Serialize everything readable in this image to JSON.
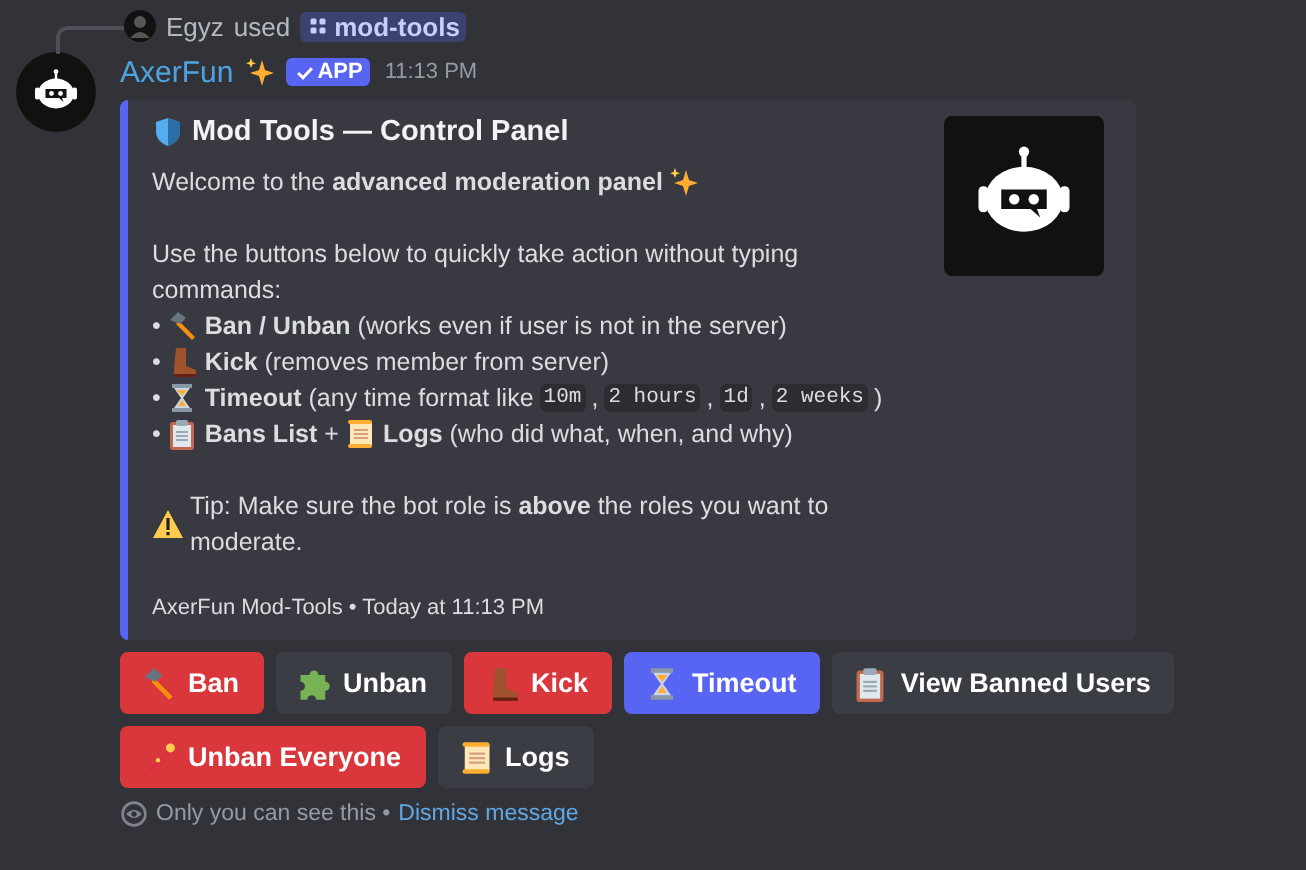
{
  "reply": {
    "user": "Egyz",
    "action": "used",
    "command": "mod-tools"
  },
  "author": {
    "name": "AxerFun",
    "badge": "APP",
    "time": "11:13 PM"
  },
  "embed": {
    "title": "Mod Tools — Control Panel",
    "paragraphs": [
      [
        {
          "parts": [
            {
              "kind": "text",
              "text": "Welcome to the **advanced moderation panel**"
            },
            {
              "kind": "sparkles"
            }
          ]
        }
      ],
      [
        {
          "parts": [
            {
              "kind": "text",
              "text": "Use the buttons below to quickly take action without typing commands:"
            }
          ]
        },
        {
          "bullet": "•",
          "parts": [
            {
              "kind": "hammer"
            },
            {
              "kind": "text",
              "text": "**Ban / Unban** (works even if user is not in the server)"
            }
          ]
        },
        {
          "bullet": "•",
          "parts": [
            {
              "kind": "boot"
            },
            {
              "kind": "text",
              "text": "**Kick** (removes member from server)"
            }
          ]
        },
        {
          "bullet": "•",
          "parts": [
            {
              "kind": "hourglass"
            },
            {
              "kind": "text",
              "text": "**Timeout** (any time format like"
            },
            {
              "kind": "code",
              "text": "10m"
            },
            {
              "kind": "text",
              "text": ","
            },
            {
              "kind": "code",
              "text": "2 hours"
            },
            {
              "kind": "text",
              "text": ","
            },
            {
              "kind": "code",
              "text": "1d"
            },
            {
              "kind": "text",
              "text": ","
            },
            {
              "kind": "code",
              "text": "2 weeks"
            },
            {
              "kind": "text",
              "text": ")"
            }
          ]
        },
        {
          "bullet": "•",
          "parts": [
            {
              "kind": "clipboard"
            },
            {
              "kind": "text",
              "text": "**Bans List** +"
            },
            {
              "kind": "scroll"
            },
            {
              "kind": "text",
              "text": "**Logs** (who did what, when, and why)"
            }
          ]
        }
      ],
      [
        {
          "parts": [
            {
              "kind": "warning"
            },
            {
              "kind": "text",
              "text": "Tip: Make sure the bot role is **above** the roles you want to moderate."
            }
          ]
        }
      ]
    ],
    "footer": "AxerFun Mod-Tools • Today at 11:13 PM"
  },
  "button_rows": [
    [
      {
        "label": "Ban",
        "kind": "ban"
      },
      {
        "label": "Unban",
        "kind": "unban"
      },
      {
        "label": "Kick",
        "kind": "kick"
      },
      {
        "label": "Timeout",
        "kind": "timeout"
      },
      {
        "label": "View Banned Users",
        "kind": "list"
      }
    ],
    [
      {
        "label": "Unban Everyone",
        "kind": "massunban"
      },
      {
        "label": "Logs",
        "kind": "logs"
      }
    ]
  ],
  "ephemeral": {
    "note": "Only you can see this •",
    "link": "Dismiss message"
  }
}
